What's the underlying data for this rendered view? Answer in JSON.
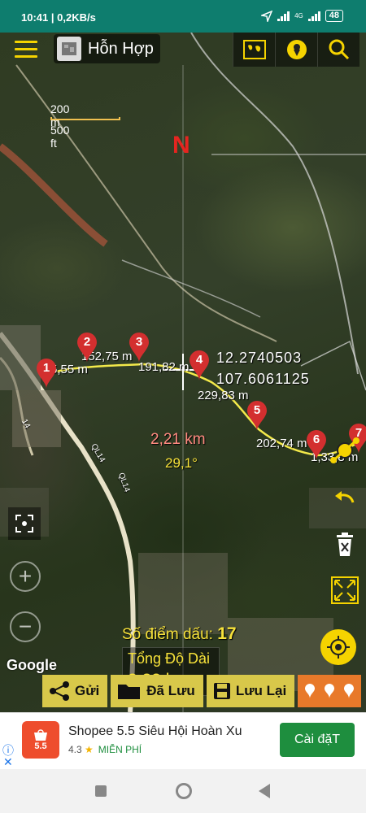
{
  "status_bar": {
    "time": "10:41",
    "speed": "0,2KB/s",
    "network": "4G",
    "battery": "48"
  },
  "toolbar": {
    "layer_name": "Hỗn Hợp",
    "icons": [
      "menu-icon",
      "world-map-icon",
      "location-pin-icon",
      "search-icon"
    ]
  },
  "map": {
    "scale_metric": "200 m",
    "scale_imperial": "500 ft",
    "north_label": "N",
    "latitude": "12.2740503",
    "longitude": "107.6061125",
    "current_segment": "2,21 km",
    "bearing": "29,1°",
    "segment_labels": [
      "5,55 m",
      "152,75 m",
      "191,82 m",
      "229,83 m",
      "202,74 m",
      "1,33,8 m"
    ],
    "road_labels": [
      "QL14",
      "QL14",
      "14"
    ],
    "markers": [
      "1",
      "2",
      "3",
      "4",
      "5",
      "6",
      "7"
    ],
    "point_count_label": "Số điểm dấu:",
    "point_count": "17",
    "total_length_label": "Tổng Độ Dài",
    "total_length": "3,23 km",
    "attribution": "Google"
  },
  "actions": {
    "send": "Gửi",
    "saved": "Đã Lưu",
    "save": "Lưu Lại"
  },
  "ad": {
    "title": "Shopee 5.5 Siêu Hội Hoàn Xu",
    "rating": "4.3",
    "price": "MIỄN PHÍ",
    "cta": "Cài đặT",
    "logo_text": "5.5",
    "accent": "#1e8e3e"
  },
  "colors": {
    "status_bar": "#0e7d6e",
    "accent_yellow": "#f5d300",
    "north": "#e52520",
    "pin": "#d32f2f"
  }
}
